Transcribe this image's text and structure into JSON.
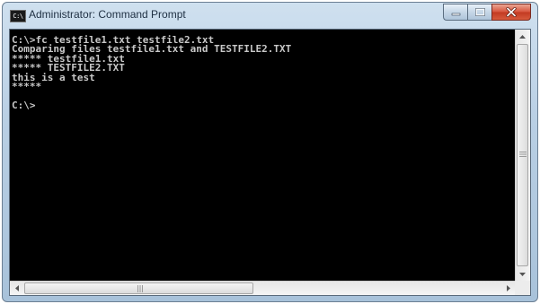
{
  "window": {
    "title": "Administrator: Command Prompt",
    "app_icon_text": "C:\\",
    "controls": [
      "minimize-icon",
      "maximize-icon",
      "close-icon"
    ]
  },
  "console": {
    "lines": [
      "C:\\>fc testfile1.txt testfile2.txt",
      "Comparing files testfile1.txt and TESTFILE2.TXT",
      "***** testfile1.txt",
      "***** TESTFILE2.TXT",
      "this is a test",
      "*****",
      "",
      "C:\\>"
    ]
  },
  "colors": {
    "console_background": "#000000",
    "console_text": "#c0c0c0",
    "close_button": "#c94a2e",
    "titlebar": "#b9cfe4"
  }
}
